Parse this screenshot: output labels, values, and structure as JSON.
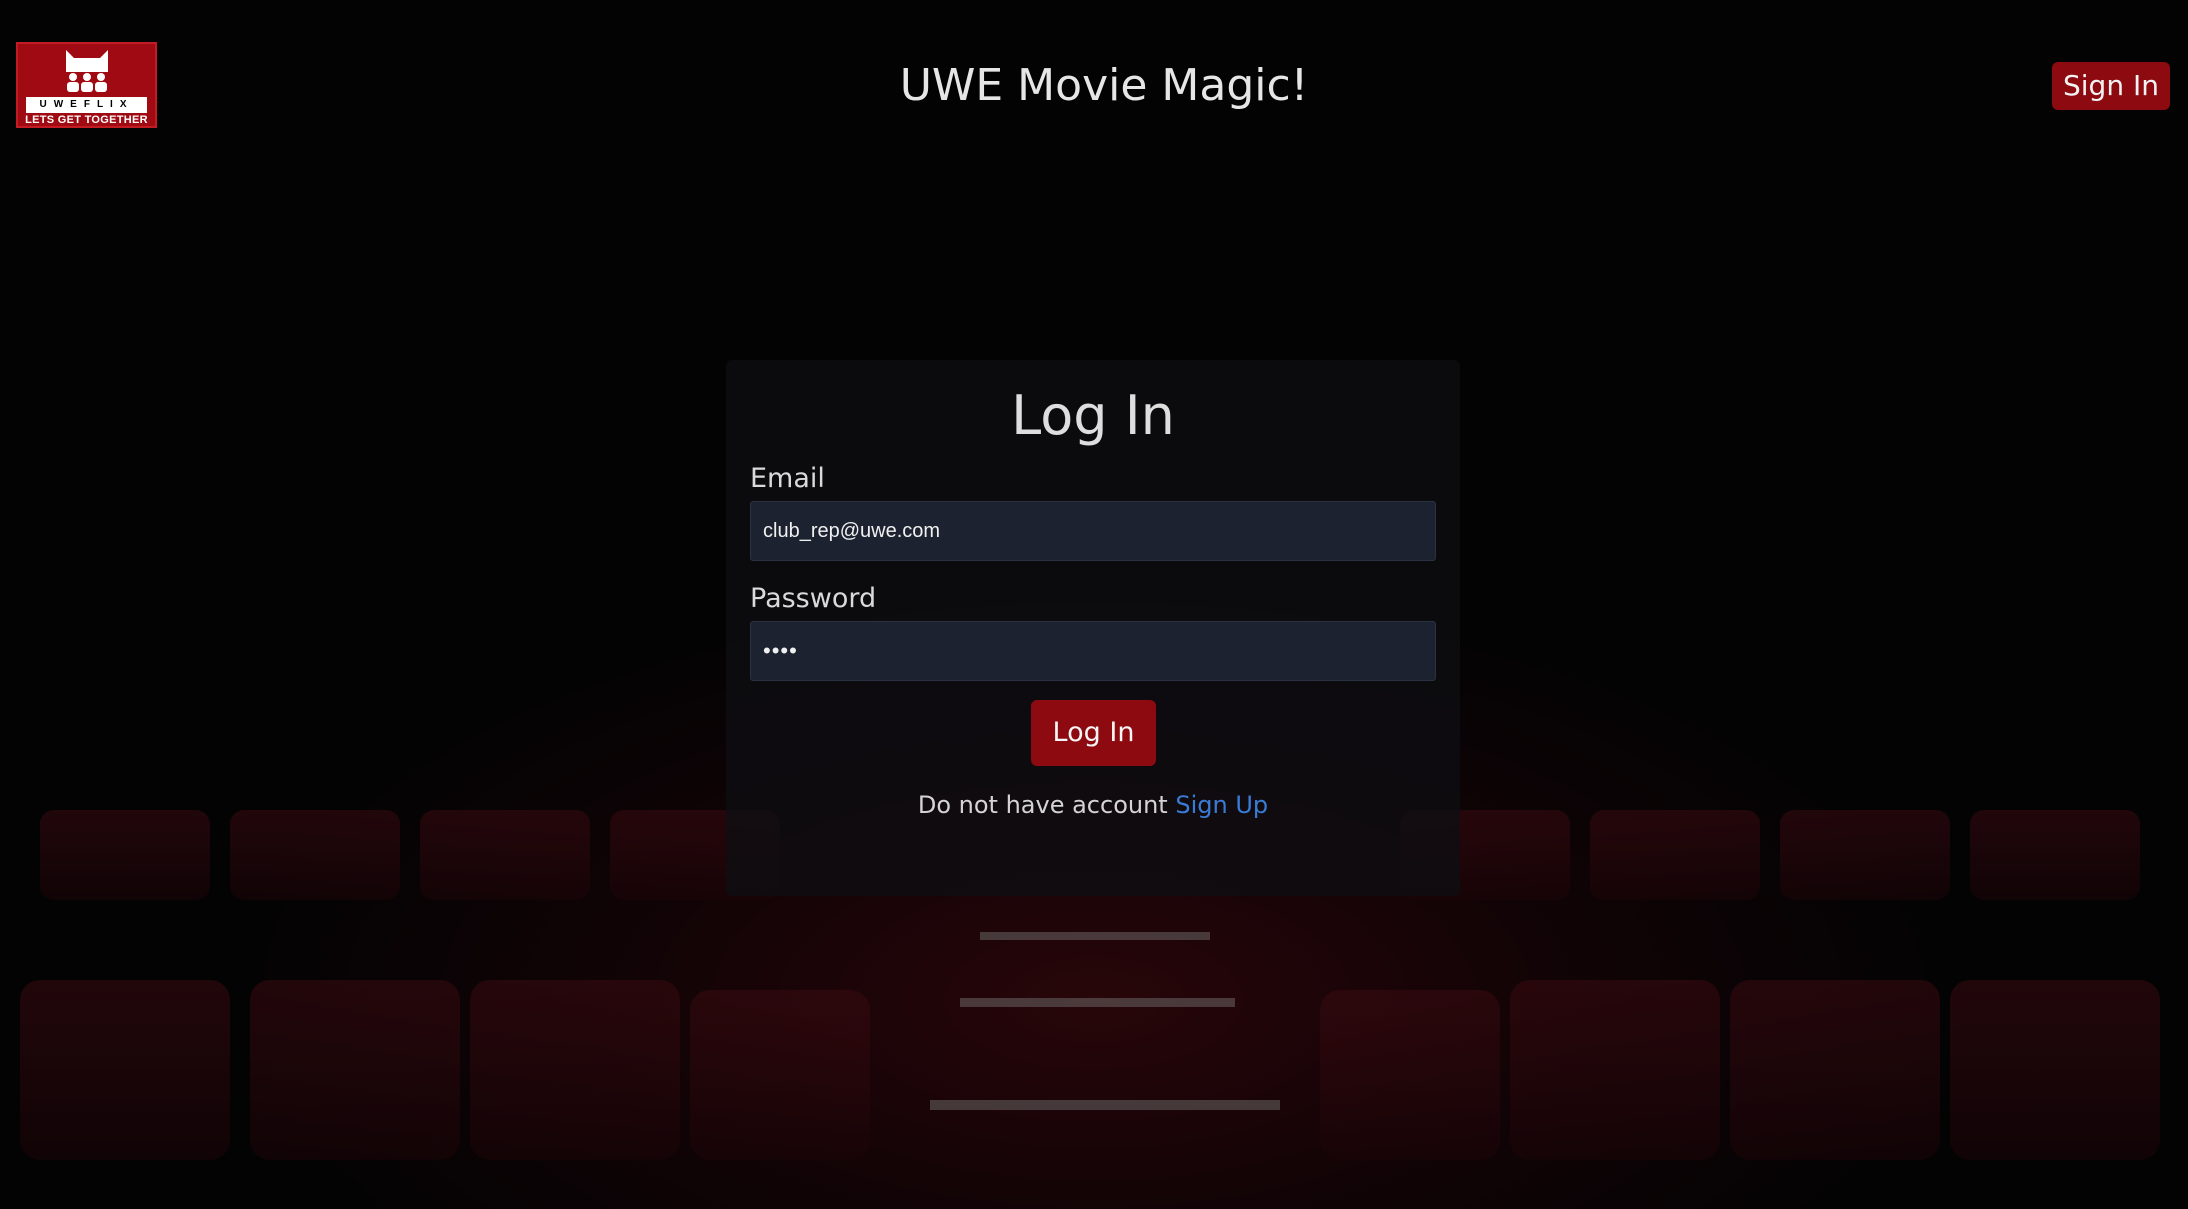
{
  "header": {
    "logo": {
      "brand": "UWEFLIX",
      "tagline": "LETS GET TOGETHER"
    },
    "title": "UWE Movie Magic!",
    "sign_in_label": "Sign In"
  },
  "login": {
    "title": "Log In",
    "email": {
      "label": "Email",
      "value": "club_rep@uwe.com"
    },
    "password": {
      "label": "Password",
      "value": "••••"
    },
    "submit_label": "Log In",
    "signup_prompt": "Do not have account",
    "signup_link": "Sign Up"
  },
  "colors": {
    "accent": "#8c0a10",
    "link": "#3a7bd5",
    "input_bg": "#1c2230",
    "background": "#030304"
  }
}
